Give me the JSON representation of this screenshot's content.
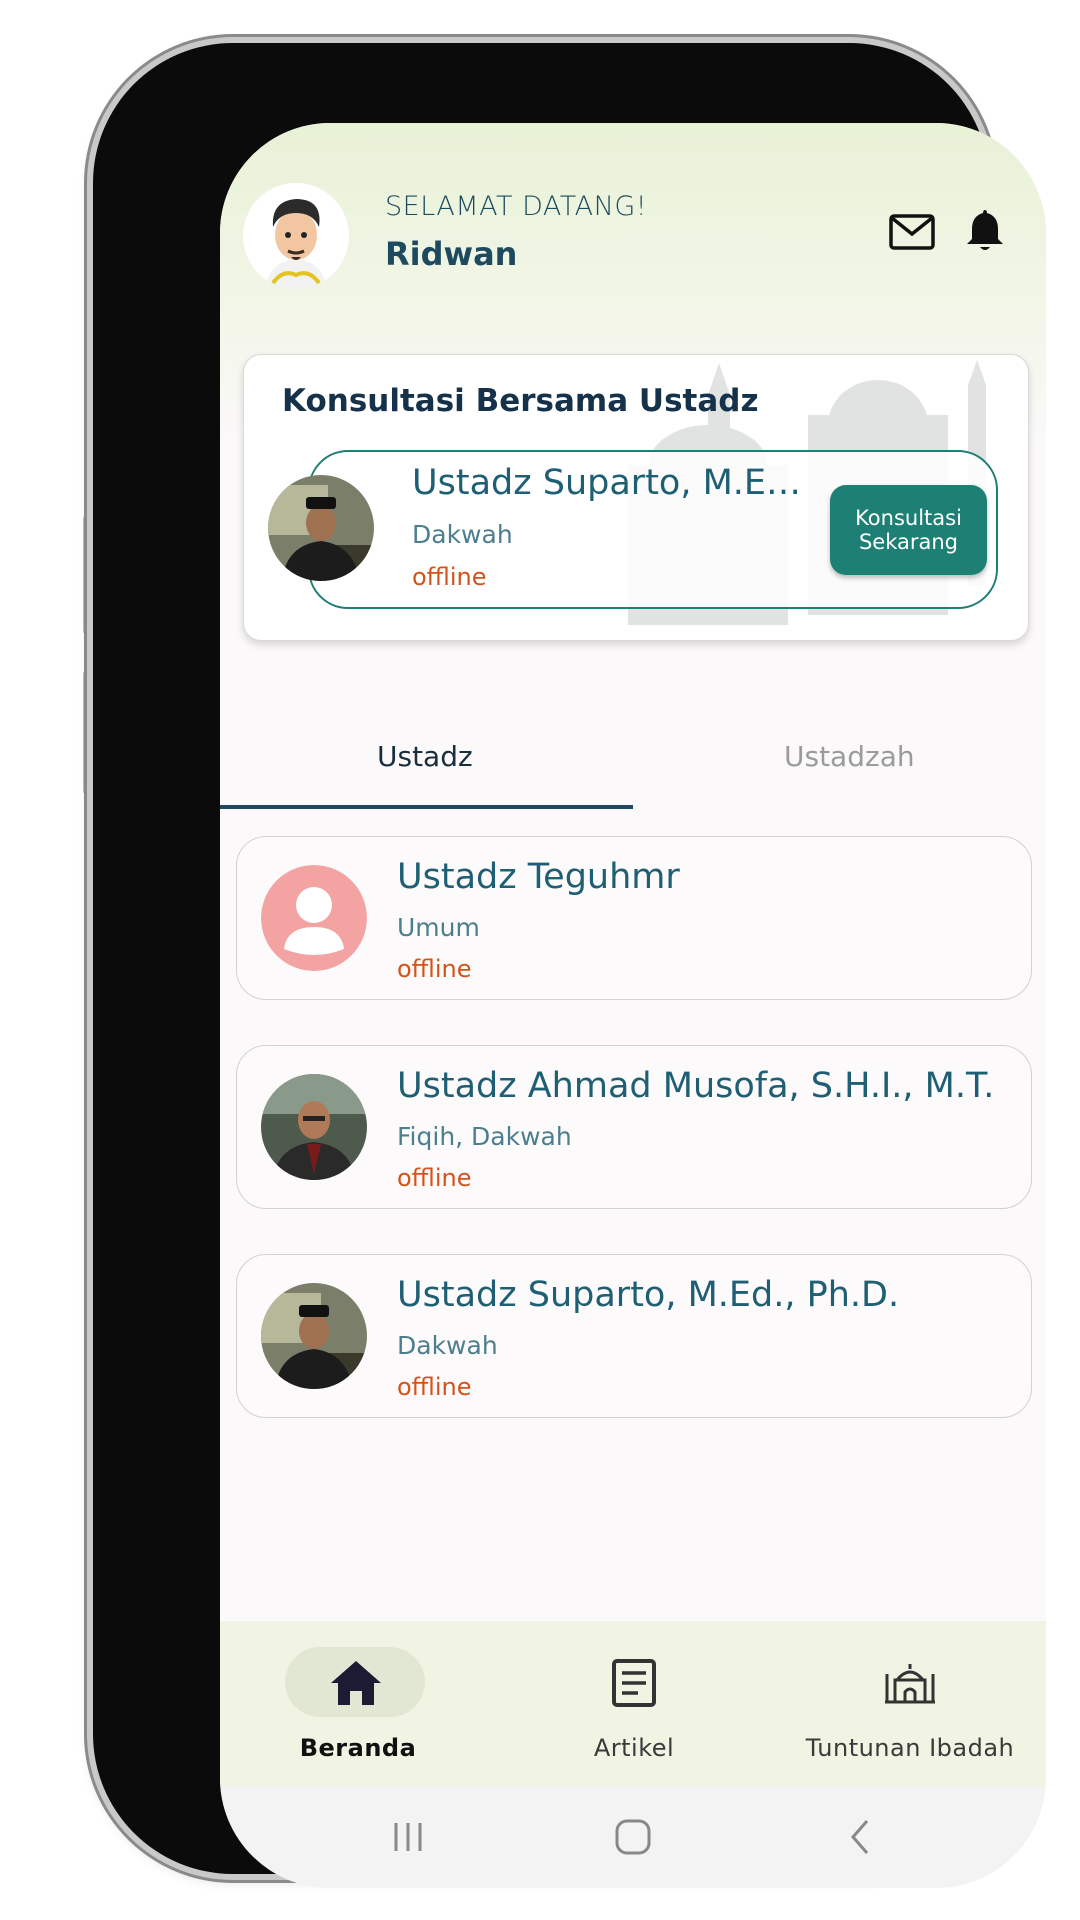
{
  "header": {
    "welcome": "SELAMAT DATANG!",
    "username": "Ridwan",
    "icons": [
      "mail-icon",
      "bell-icon"
    ]
  },
  "featured": {
    "title": "Konsultasi Bersama Ustadz",
    "name": "Ustadz Suparto, M.E…",
    "specialty": "Dakwah",
    "status": "offline",
    "button_line1": "Konsultasi",
    "button_line2": "Sekarang"
  },
  "tabs": [
    {
      "label": "Ustadz",
      "active": true
    },
    {
      "label": "Ustadzah",
      "active": false
    }
  ],
  "list": [
    {
      "name": "Ustadz Teguhmr",
      "specialty": "Umum",
      "status": "offline",
      "avatar": "default-avatar-icon"
    },
    {
      "name": "Ustadz Ahmad Musofa, S.H.I., M.T.",
      "specialty": "Fiqih, Dakwah",
      "status": "offline",
      "avatar": "photo"
    },
    {
      "name": "Ustadz Suparto, M.Ed., Ph.D.",
      "specialty": "Dakwah",
      "status": "offline",
      "avatar": "photo"
    }
  ],
  "bottom_nav": [
    {
      "label": "Beranda",
      "icon": "home-icon",
      "active": true
    },
    {
      "label": "Artikel",
      "icon": "article-icon",
      "active": false
    },
    {
      "label": "Tuntunan Ibadah",
      "icon": "mosque-icon",
      "active": false
    }
  ],
  "colors": {
    "accent": "#1e7f75",
    "title": "#1d4a5e",
    "status_offline": "#d2541c",
    "header_bg": "#e8f2d6",
    "nav_bg": "#f1f4e3"
  }
}
